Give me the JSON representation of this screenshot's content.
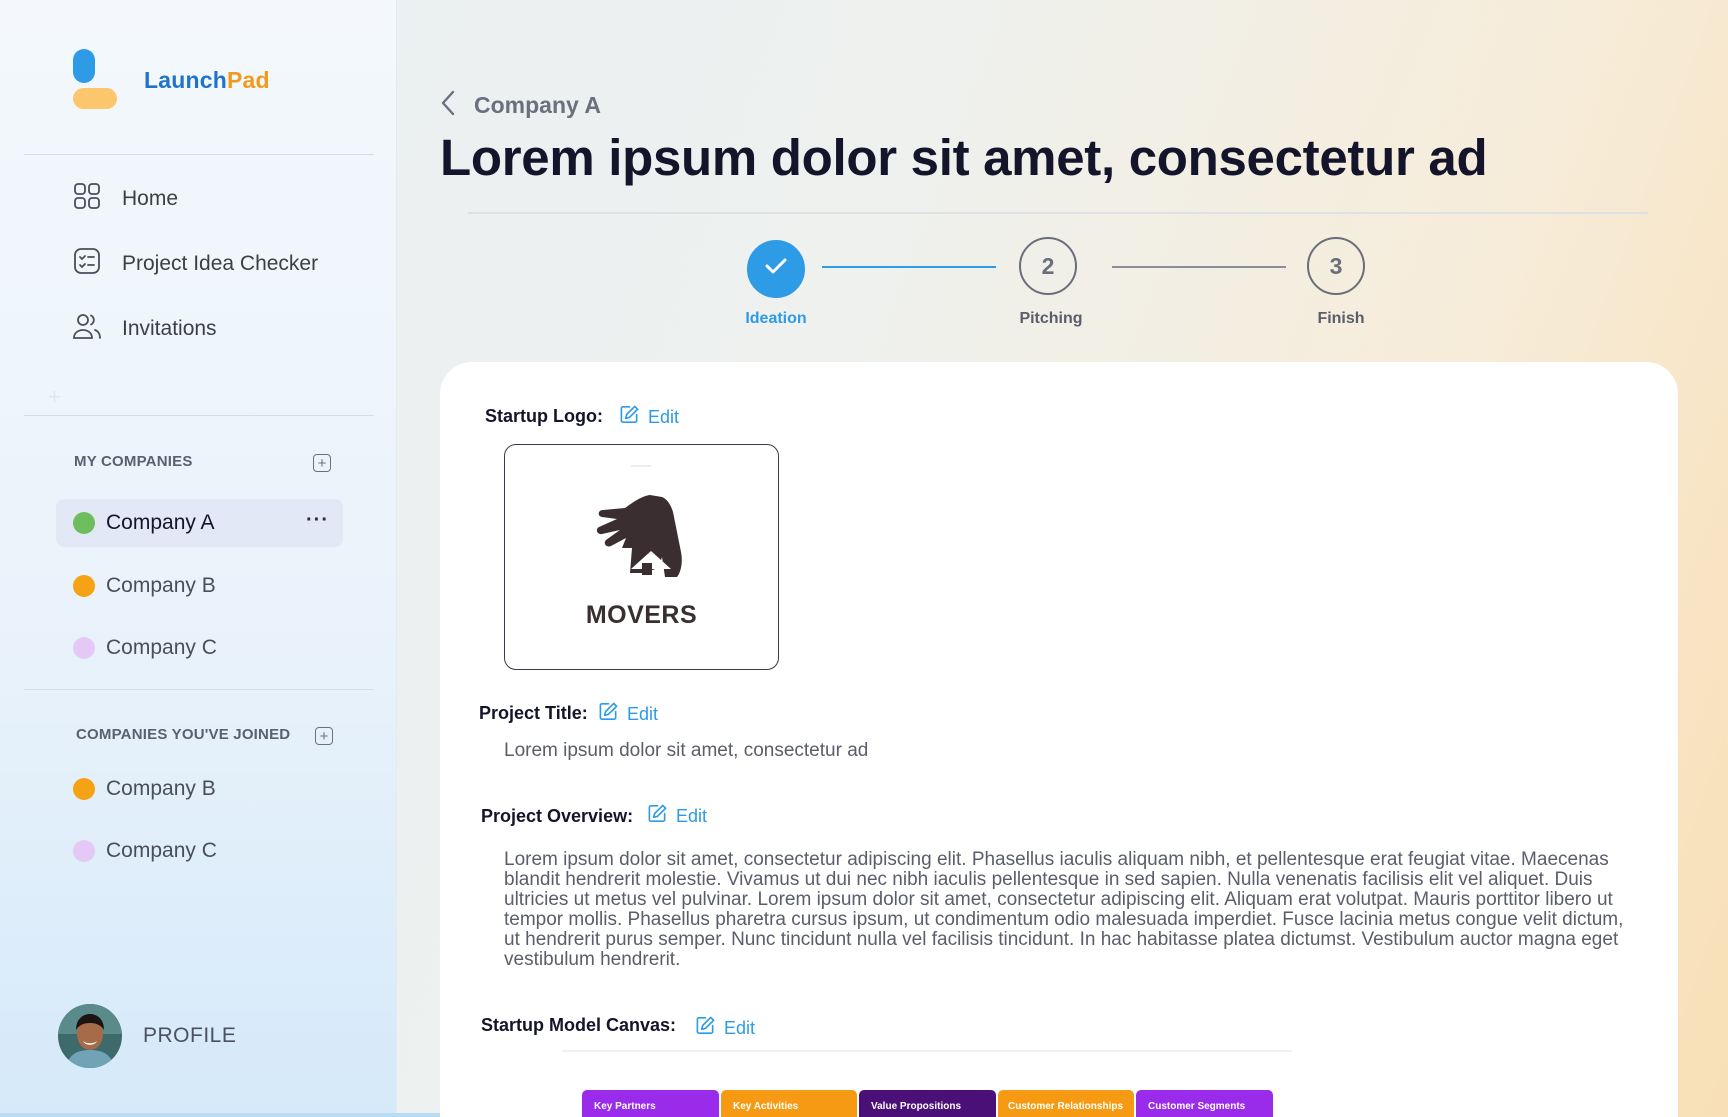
{
  "app": {
    "brand_part1": "Launch",
    "brand_part2": "Pad",
    "colors": {
      "brand_blue": "#2d9be5",
      "brand_yellow": "#fcc66d",
      "brand_text_blue": "#1f74c9",
      "brand_text_orange": "#f39a1e"
    }
  },
  "sidebar": {
    "nav": [
      {
        "label": "Home",
        "icon": "grid-icon"
      },
      {
        "label": "Project Idea Checker",
        "icon": "checklist-icon"
      },
      {
        "label": "Invitations",
        "icon": "users-icon"
      }
    ],
    "my_companies": {
      "title": "MY COMPANIES",
      "items": [
        {
          "name": "Company A",
          "color": "#6fbe5e",
          "active": true
        },
        {
          "name": "Company B",
          "color": "#f5a214",
          "active": false
        },
        {
          "name": "Company C",
          "color": "#e4c9f6",
          "active": false
        }
      ]
    },
    "joined_companies": {
      "title": "COMPANIES YOU'VE JOINED",
      "items": [
        {
          "name": "Company B",
          "color": "#f5a214"
        },
        {
          "name": "Company C",
          "color": "#e4c9f6"
        }
      ]
    },
    "profile_label": "PROFILE"
  },
  "main": {
    "breadcrumb": "Company A",
    "title": "Lorem ipsum dolor sit amet, consectetur ad",
    "steps": [
      {
        "label": "Ideation",
        "number": "1",
        "status": "done",
        "color": "#2d9be5"
      },
      {
        "label": "Pitching",
        "number": "2",
        "status": "pending"
      },
      {
        "label": "Finish",
        "number": "3",
        "status": "pending"
      }
    ],
    "edit_label": "Edit",
    "startup_logo": {
      "label": "Startup Logo:",
      "logo_text": "MOVERS"
    },
    "project_title": {
      "label": "Project Title:",
      "value": "Lorem ipsum dolor sit amet, consectetur ad"
    },
    "project_overview": {
      "label": "Project Overview:",
      "value": "Lorem ipsum dolor sit amet, consectetur adipiscing elit. Phasellus iaculis aliquam nibh, et pellentesque erat feugiat vitae. Maecenas blandit hendrerit molestie. Vivamus ut dui nec nibh iaculis pellentesque in sed sapien. Nulla venenatis facilisis elit vel aliquet. Duis ultricies ut metus vel pulvinar. Lorem ipsum dolor sit amet, consectetur adipiscing elit. Aliquam erat volutpat. Mauris porttitor libero ut tempor mollis. Phasellus pharetra cursus ipsum, ut condimentum odio malesuada imperdiet. Fusce lacinia metus congue velit dictum, ut hendrerit purus semper. Nunc tincidunt nulla vel facilisis tincidunt. In hac habitasse platea dictumst. Vestibulum auctor magna eget vestibulum hendrerit."
    },
    "canvas": {
      "label": "Startup Model Canvas:",
      "columns": [
        {
          "label": "Key Partners",
          "color": "#9b2bea"
        },
        {
          "label": "Key Activities",
          "color": "#f59a12"
        },
        {
          "label": "Value Propositions",
          "color": "#4b0f78"
        },
        {
          "label": "Customer Relationships",
          "color": "#f59a12"
        },
        {
          "label": "Customer Segments",
          "color": "#9b2bea"
        }
      ]
    }
  }
}
